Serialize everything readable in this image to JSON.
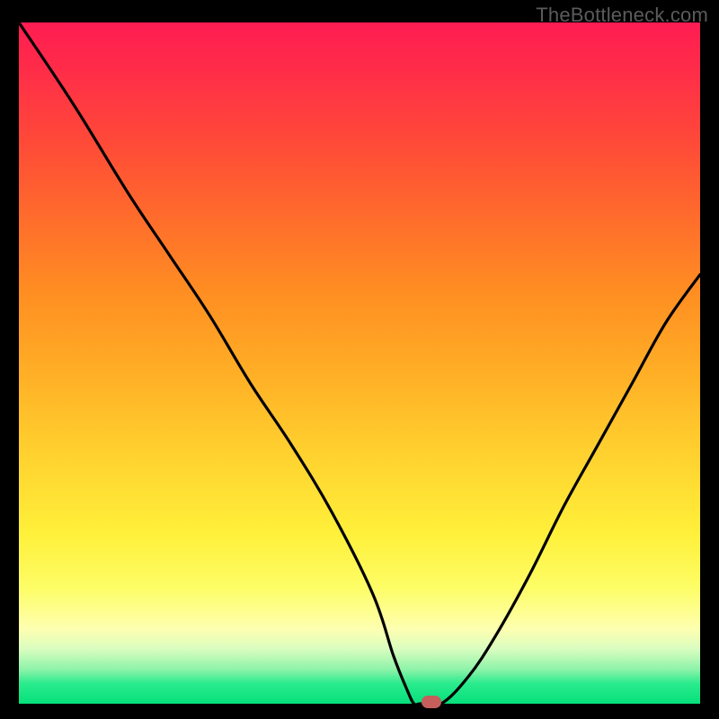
{
  "watermark": "TheBottleneck.com",
  "chart_data": {
    "type": "line",
    "title": "",
    "xlabel": "",
    "ylabel": "",
    "xlim": [
      0,
      100
    ],
    "ylim": [
      0,
      100
    ],
    "grid": false,
    "legend": false,
    "series": [
      {
        "name": "curve",
        "x": [
          0,
          8,
          16,
          22,
          28,
          34,
          40,
          46,
          52,
          55,
          57,
          58,
          59,
          62,
          66,
          70,
          75,
          80,
          85,
          90,
          95,
          100
        ],
        "values": [
          100,
          88,
          75,
          66,
          57,
          47,
          38,
          28,
          16,
          7,
          2,
          0,
          0,
          0,
          4,
          10,
          19,
          29,
          38,
          47,
          56,
          63
        ]
      }
    ],
    "marker": {
      "x": 60.5,
      "y": 0
    },
    "background_gradient": {
      "top": "#ff1c52",
      "bottom": "#05e07b"
    }
  }
}
